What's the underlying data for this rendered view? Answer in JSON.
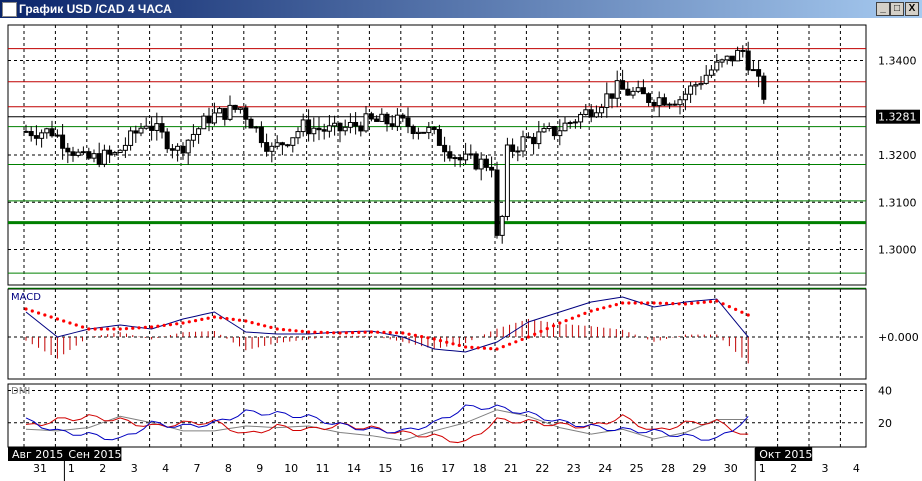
{
  "window": {
    "title": "График USD /CAD  4 ЧАСА",
    "minimize": "_",
    "maximize": "□",
    "close": "X"
  },
  "chart_data": {
    "type": "candlestick",
    "title": "График USD /CAD  4 ЧАСА",
    "days": [
      "31",
      "1",
      "2",
      "3",
      "4",
      "7",
      "8",
      "9",
      "10",
      "11",
      "14",
      "15",
      "16",
      "17",
      "18",
      "21",
      "22",
      "23",
      "24",
      "25",
      "28",
      "29",
      "30",
      "1",
      "2",
      "3",
      "4"
    ],
    "month_labels": [
      {
        "label": "Авг 2015",
        "day_index": 0
      },
      {
        "label": "Сен 2015",
        "day_index": 1
      },
      {
        "label": "Окт 2015",
        "day_index": 23
      }
    ],
    "price": {
      "ylim": [
        1.2925,
        1.3475
      ],
      "ticks": [
        "1.3400",
        "1.3200",
        "1.3100",
        "1.3000"
      ],
      "tick_values": [
        1.34,
        1.32,
        1.31,
        1.3
      ],
      "last_price": "1.3281",
      "last_value": 1.3281,
      "daily_close": [
        1.325,
        1.319,
        1.32,
        1.327,
        1.321,
        1.328,
        1.33,
        1.321,
        1.326,
        1.325,
        1.327,
        1.327,
        1.325,
        1.319,
        1.318,
        1.323,
        1.325,
        1.329,
        1.334,
        1.332,
        1.332,
        1.338,
        1.342,
        1.3281
      ],
      "resistance_lines": [
        1.3425,
        1.3355,
        1.3302
      ],
      "support_lines": [
        1.326,
        1.318,
        1.3103,
        1.3057,
        1.295,
        1.2918
      ],
      "colors": {
        "resistance": "#c00000",
        "support": "#008000",
        "candle": "#000000"
      }
    },
    "macd": {
      "label": "MACD",
      "zero_label": "+0.000",
      "line": [
        25,
        0,
        8,
        12,
        8,
        18,
        25,
        5,
        3,
        3,
        5,
        6,
        0,
        -12,
        -15,
        -5,
        15,
        25,
        35,
        40,
        30,
        35,
        38,
        0
      ],
      "signal": [
        28,
        18,
        8,
        8,
        10,
        14,
        20,
        16,
        8,
        5,
        4,
        5,
        4,
        -2,
        -10,
        -12,
        0,
        14,
        26,
        34,
        34,
        33,
        36,
        22
      ],
      "colors": {
        "line": "#000080",
        "signal": "#ff0000",
        "histogram": "#c00000"
      }
    },
    "dmi": {
      "label": "DMI",
      "ticks": [
        "40",
        "20"
      ],
      "tick_values": [
        40,
        20
      ],
      "ylim": [
        5,
        44
      ],
      "plus_di": [
        22,
        15,
        13,
        10,
        20,
        18,
        20,
        27,
        26,
        24,
        19,
        16,
        15,
        20,
        30,
        30,
        26,
        21,
        18,
        16,
        15,
        12,
        10,
        23
      ],
      "minus_di": [
        18,
        22,
        24,
        22,
        18,
        20,
        21,
        13,
        18,
        16,
        19,
        17,
        14,
        12,
        8,
        22,
        21,
        19,
        18,
        24,
        15,
        20,
        21,
        12
      ],
      "adx": [
        16,
        15,
        17,
        24,
        20,
        15,
        15,
        18,
        17,
        18,
        14,
        12,
        9,
        15,
        20,
        28,
        24,
        17,
        13,
        16,
        10,
        14,
        22,
        22
      ],
      "colors": {
        "plus_di": "#0000c0",
        "minus_di": "#d00000",
        "adx": "#808080"
      }
    }
  }
}
